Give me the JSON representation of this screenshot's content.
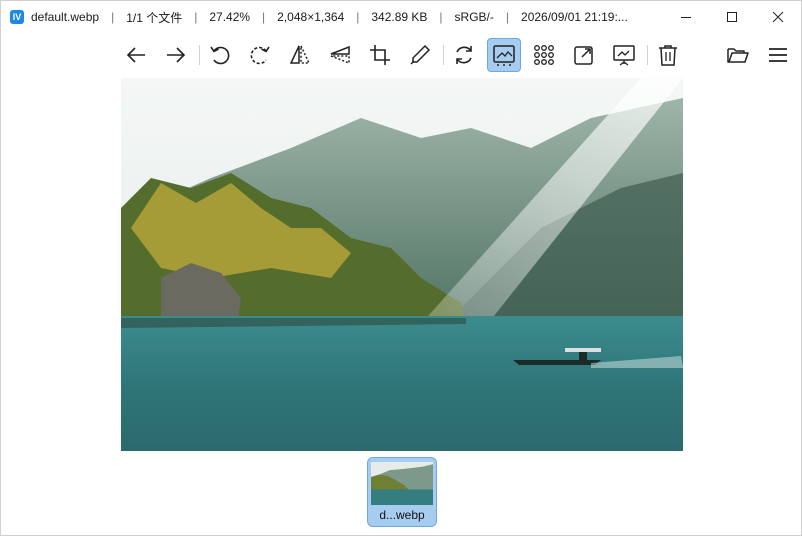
{
  "titlebar": {
    "filename": "default.webp",
    "index": "1/1 个文件",
    "zoom": "27.42%",
    "dimensions": "2,048×1,364",
    "filesize": "342.89 KB",
    "colorspace": "sRGB/-",
    "datetime": "2026/09/01 21:19:..."
  },
  "toolbar": {
    "icons": [
      "arrow-left-icon",
      "arrow-right-icon",
      "rotate-left-icon",
      "rotate-right-icon",
      "flip-horizontal-icon",
      "flip-vertical-icon",
      "crop-icon",
      "color-picker-icon",
      "refresh-icon",
      "image-view-icon",
      "gallery-grid-icon",
      "fit-window-icon",
      "slideshow-icon",
      "trash-icon",
      "folder-open-icon",
      "menu-icon"
    ],
    "active": "image-view-icon"
  },
  "thumbnail": {
    "label": "d...webp",
    "selected": true
  },
  "colors": {
    "accent": "#a6cdf0",
    "accent_border": "#6fa8dc",
    "app_icon": "#1e88e5"
  }
}
